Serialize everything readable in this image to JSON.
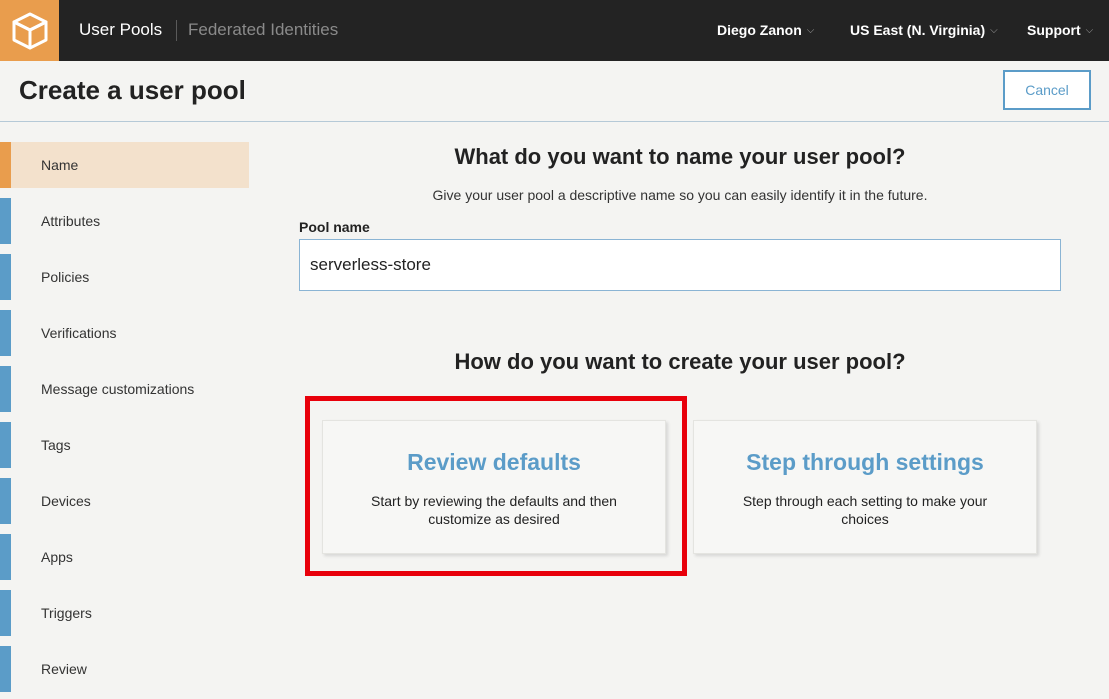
{
  "topbar": {
    "logo_icon": "aws-cube-icon",
    "brand": "User Pools",
    "nav_link": "Federated Identities",
    "user_menu": "Diego Zanon",
    "region_menu": "US East (N. Virginia)",
    "support_menu": "Support",
    "caret": "⌵"
  },
  "header": {
    "title": "Create a user pool",
    "cancel_label": "Cancel"
  },
  "sidebar": {
    "items": [
      {
        "label": "Name",
        "active": true
      },
      {
        "label": "Attributes"
      },
      {
        "label": "Policies"
      },
      {
        "label": "Verifications"
      },
      {
        "label": "Message customizations"
      },
      {
        "label": "Tags"
      },
      {
        "label": "Devices"
      },
      {
        "label": "Apps"
      },
      {
        "label": "Triggers"
      },
      {
        "label": "Review"
      }
    ]
  },
  "main": {
    "name_heading": "What do you want to name your user pool?",
    "name_subtext": "Give your user pool a descriptive name so you can easily identify it in the future.",
    "pool_name_label": "Pool name",
    "pool_name_value": "serverless-store",
    "create_heading": "How do you want to create your user pool?",
    "options": [
      {
        "title": "Review defaults",
        "description": "Start by reviewing the defaults and then customize as desired"
      },
      {
        "title": "Step through settings",
        "description": "Step through each setting to make your choices"
      }
    ]
  },
  "colors": {
    "accent_orange": "#e99d4d",
    "accent_blue": "#5b9cc8",
    "highlight_red": "#e8000b",
    "topbar_bg": "#232323"
  }
}
